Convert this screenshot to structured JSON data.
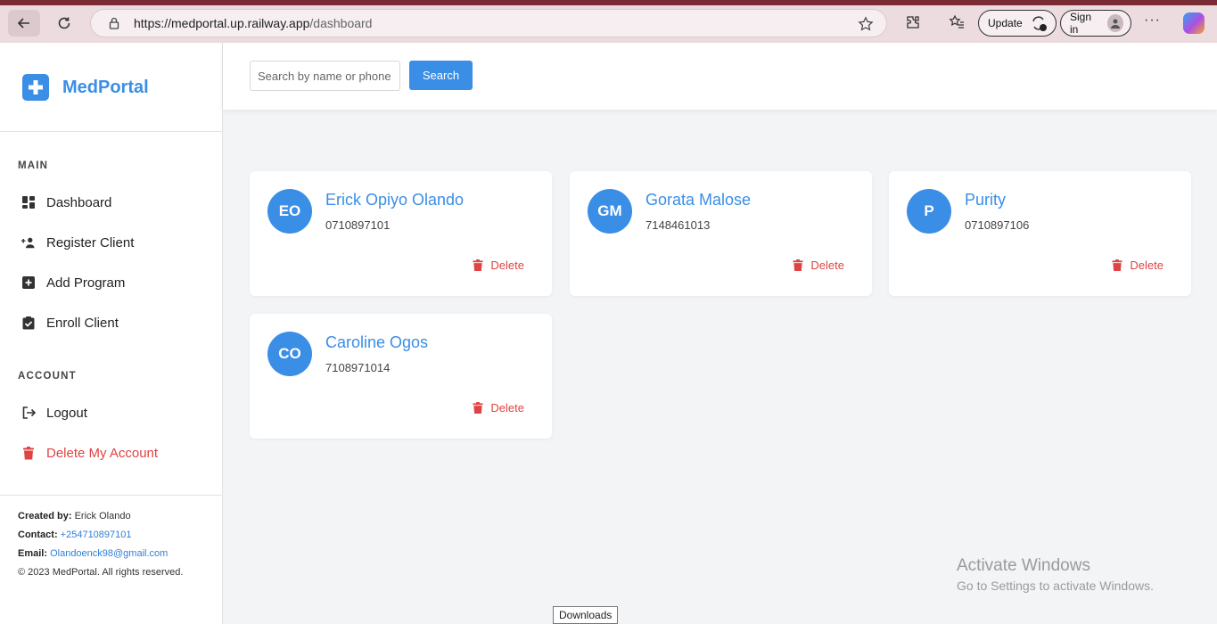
{
  "browser": {
    "url_base": "https://medportal.up.railway.app",
    "url_path": "/dashboard",
    "update_label": "Update",
    "signin_label": "Sign in",
    "more_label": "···"
  },
  "sidebar": {
    "logo_text": "MedPortal",
    "main_label": "MAIN",
    "main_items": [
      {
        "label": "Dashboard",
        "icon": "dashboard-icon"
      },
      {
        "label": "Register Client",
        "icon": "user-plus-icon"
      },
      {
        "label": "Add Program",
        "icon": "plus-square-icon"
      },
      {
        "label": "Enroll Client",
        "icon": "clipboard-check-icon"
      }
    ],
    "account_label": "ACCOUNT",
    "account_items": [
      {
        "label": "Logout",
        "icon": "logout-icon"
      },
      {
        "label": "Delete My Account",
        "icon": "trash-icon"
      }
    ],
    "footer": {
      "created_by_label": "Created by:",
      "created_by_value": "Erick Olando",
      "contact_label": "Contact:",
      "contact_value": "+254710897101",
      "email_label": "Email:",
      "email_value": "Olandoenck98@gmail.com",
      "copyright": "© 2023 MedPortal. All rights reserved."
    }
  },
  "search": {
    "placeholder": "Search by name or phone",
    "button_label": "Search"
  },
  "clients": [
    {
      "initials": "EO",
      "name": "Erick Opiyo Olando",
      "phone": "0710897101",
      "delete_label": "Delete"
    },
    {
      "initials": "GM",
      "name": "Gorata Malose",
      "phone": "7148461013",
      "delete_label": "Delete"
    },
    {
      "initials": "P",
      "name": "Purity",
      "phone": "0710897106",
      "delete_label": "Delete"
    },
    {
      "initials": "CO",
      "name": "Caroline Ogos",
      "phone": "7108971014",
      "delete_label": "Delete"
    }
  ],
  "watermark": {
    "title": "Activate Windows",
    "subtitle": "Go to Settings to activate Windows."
  },
  "tooltip": "Downloads",
  "colors": {
    "accent": "#3a8ee6",
    "danger": "#e04343",
    "background": "#f3f4f6"
  }
}
